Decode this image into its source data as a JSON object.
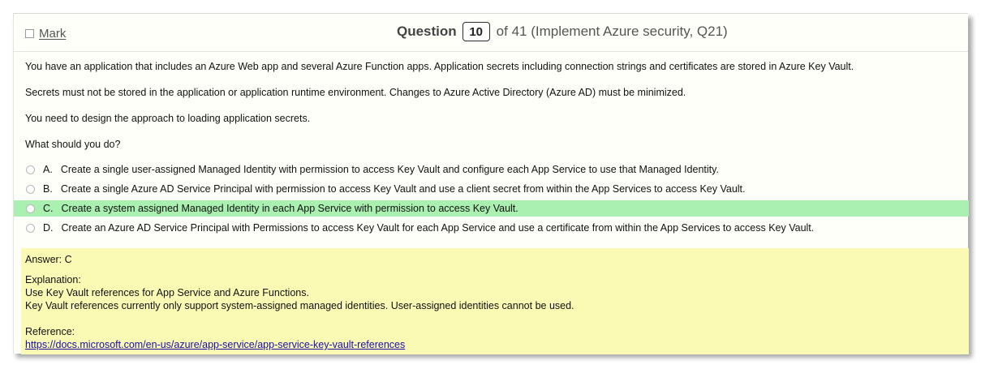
{
  "header": {
    "mark_label": "Mark",
    "question_word": "Question",
    "question_number": "10",
    "question_of": "of 41 (Implement Azure security, Q21)"
  },
  "question": {
    "paragraphs": [
      "You have an application that includes an Azure Web app and several Azure Function apps. Application secrets including connection strings and certificates are stored in Azure Key Vault.",
      "Secrets must not be stored in the application or application runtime environment. Changes to Azure Active Directory (Azure AD) must be minimized.",
      "You need to design the approach to loading application secrets.",
      "What should you do?"
    ],
    "options": [
      {
        "letter": "A.",
        "text": "Create a single user-assigned Managed Identity with permission to access Key Vault and configure each App Service to use that Managed Identity."
      },
      {
        "letter": "B.",
        "text": "Create a single Azure AD Service Principal with permission to access Key Vault and use a client secret from within the App Services to access Key Vault."
      },
      {
        "letter": "C.",
        "text": "Create a system assigned Managed Identity in each App Service with permission to access Key Vault."
      },
      {
        "letter": "D.",
        "text": "Create an Azure AD Service Principal with Permissions to access Key Vault for each App Service and use a certificate from within the App Services to access Key Vault."
      }
    ],
    "highlighted_option": "C"
  },
  "answer": {
    "answer_line": "Answer: C",
    "explanation_label": "Explanation:",
    "explanation_lines": [
      "Use Key Vault references for App Service and Azure Functions.",
      "Key Vault references currently only support system-assigned managed identities. User-assigned identities cannot be used."
    ],
    "reference_label": "Reference:",
    "reference_link": "https://docs.microsoft.com/en-us/azure/app-service/app-service-key-vault-references"
  },
  "colors": {
    "correct_highlight": "#a9f0b1",
    "answer_background": "#fafab4",
    "link": "#1a0dab"
  }
}
